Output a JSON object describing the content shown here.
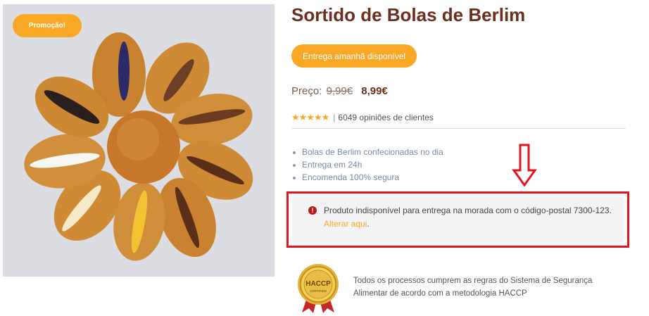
{
  "product": {
    "title": "Sortido de Bolas de Berlim",
    "promo_badge": "Promoção!",
    "delivery_badge": "Entrega amanhã disponível",
    "price_label": "Preço:",
    "price_old": "9,99€",
    "price_new": "8,99€",
    "rating_stars": "★★★★★",
    "rating_value_fraction": 1.0,
    "reviews_text": "6049 opiniões de clientes",
    "features": [
      "Bolas de Berlim confecionadas no dia",
      "Entrega em 24h",
      "Encomenda 100% segura"
    ]
  },
  "alert": {
    "icon": "exclamation-icon",
    "message": "Produto indisponível para entrega na morada com o código-postal 7300-123.",
    "link_text": "Alterar aqui",
    "link_suffix": "."
  },
  "certification": {
    "seal_text_top": "HACCP",
    "seal_text_bottom": "CERTIFIED",
    "text_line1": "Todos os processos cumprem as regras do Sistema de Segurança",
    "text_line2": "Alimentar de acordo com a metodologia HACCP"
  },
  "colors": {
    "accent": "#f9a825",
    "title": "#6b2e1f",
    "alert_border": "#e0151f",
    "alert_icon": "#b71c1c"
  }
}
